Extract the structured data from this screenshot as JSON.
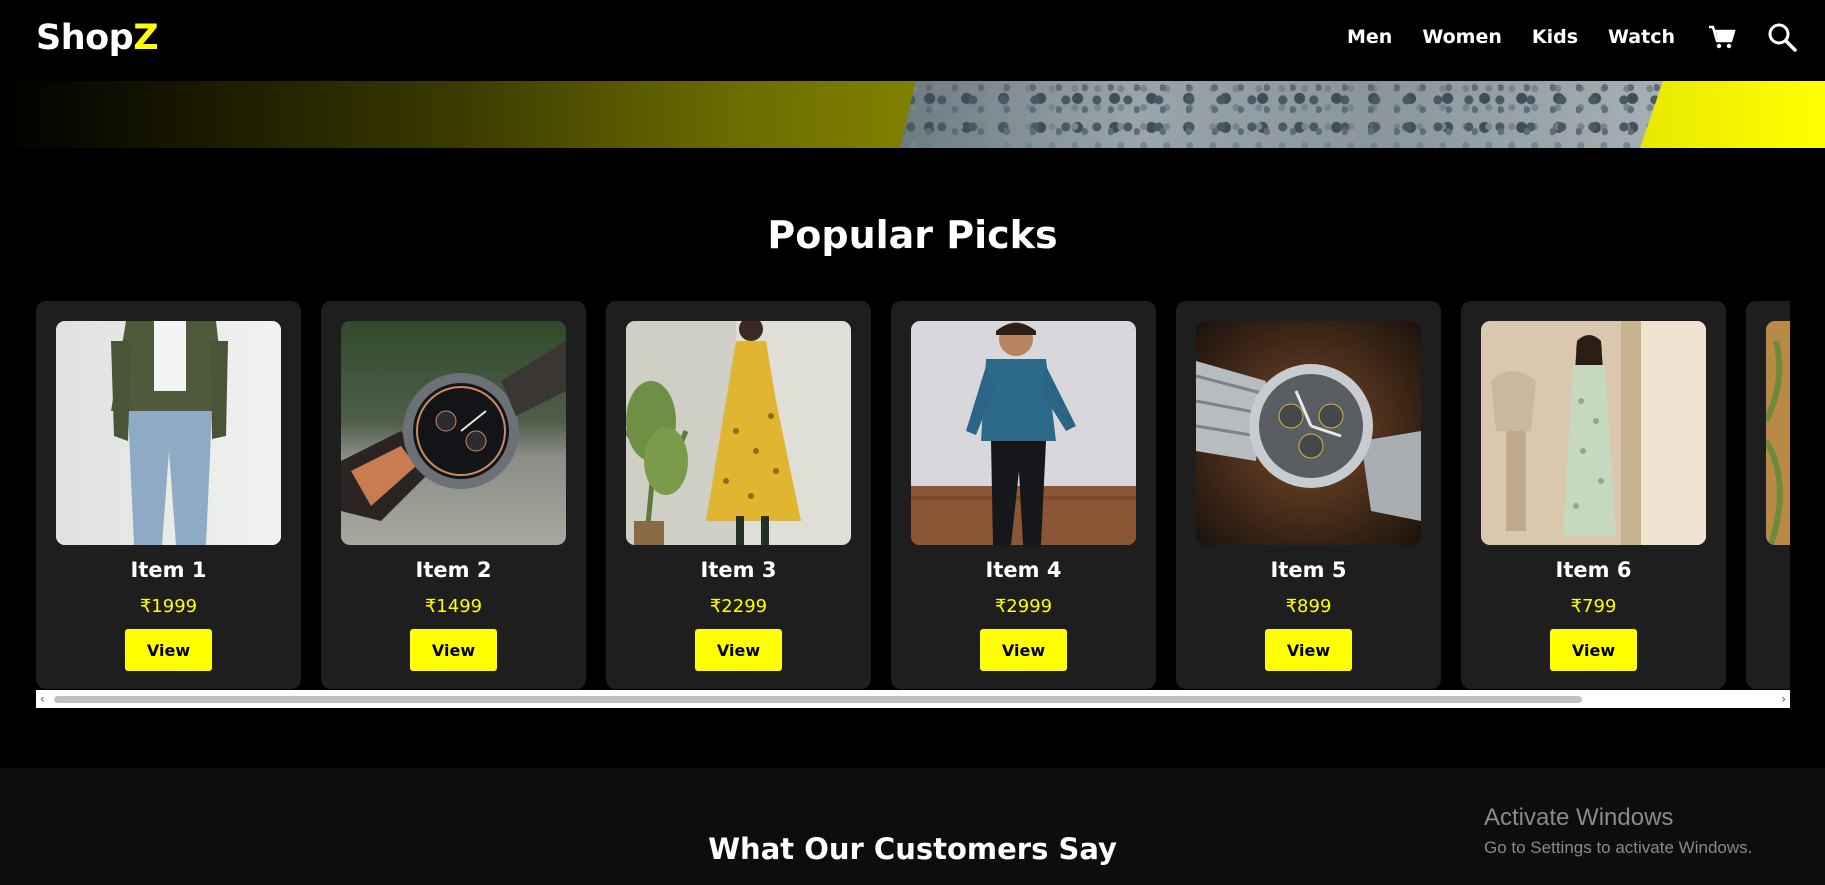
{
  "brand": {
    "logo_main": "Shop",
    "logo_accent": "Z",
    "accent_color": "#ffff00"
  },
  "nav": {
    "links": [
      "Men",
      "Women",
      "Kids",
      "Watch"
    ],
    "cart_icon": "cart-icon",
    "search_icon": "search-icon"
  },
  "popular": {
    "title": "Popular Picks",
    "items": [
      {
        "name": "Item 1",
        "price": "₹1999",
        "button": "View",
        "image": "man-jacket-jeans"
      },
      {
        "name": "Item 2",
        "price": "₹1499",
        "button": "View",
        "image": "wristwatch-on-stone"
      },
      {
        "name": "Item 3",
        "price": "₹2299",
        "button": "View",
        "image": "yellow-kurta-dress"
      },
      {
        "name": "Item 4",
        "price": "₹2999",
        "button": "View",
        "image": "kid-denim-shirt"
      },
      {
        "name": "Item 5",
        "price": "₹899",
        "button": "View",
        "image": "steel-chronograph-watch"
      },
      {
        "name": "Item 6",
        "price": "₹799",
        "button": "View",
        "image": "woman-green-kurta"
      }
    ]
  },
  "testimonials": {
    "title": "What Our Customers Say"
  },
  "os_overlay": {
    "line1": "Activate Windows",
    "line2": "Go to Settings to activate Windows."
  }
}
